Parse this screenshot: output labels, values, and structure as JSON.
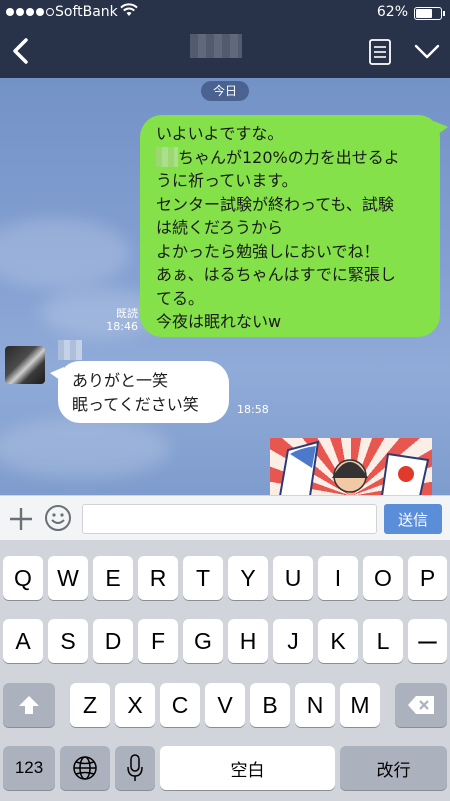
{
  "status_bar": {
    "carrier": "SoftBank",
    "signal_bars": 4,
    "battery_text": "62%",
    "battery_level": 0.62
  },
  "nav": {
    "back_icon": "chevron-left-icon",
    "notes_icon": "notes-icon",
    "menu_icon": "chevron-down-icon"
  },
  "chat": {
    "date_label": "今日",
    "outgoing": {
      "lines": [
        "いよいよですな。",
        "ちゃんが120%の力を出せるよ",
        "うに祈っています。",
        "センター試験が終わっても、試験",
        "は続くだろうから",
        "よかったら勉強しにおいでね！",
        "あぁ、はるちゃんはすでに緊張し",
        "てる。",
        "今夜は眠れないw"
      ],
      "read_label": "既読",
      "time": "18:46"
    },
    "incoming": {
      "lines": [
        "ありがと一笑",
        "眠ってください笑"
      ],
      "time": "18:58"
    }
  },
  "input_bar": {
    "plus_icon": "plus-icon",
    "emoji_icon": "smiley-icon",
    "message_value": "",
    "send_label": "送信"
  },
  "keyboard": {
    "row1": [
      "Q",
      "W",
      "E",
      "R",
      "T",
      "Y",
      "U",
      "I",
      "O",
      "P"
    ],
    "row2": [
      "A",
      "S",
      "D",
      "F",
      "G",
      "H",
      "J",
      "K",
      "L",
      "ー"
    ],
    "row3": [
      "Z",
      "X",
      "C",
      "V",
      "B",
      "N",
      "M"
    ],
    "numbers_label": "123",
    "space_label": "空白",
    "return_label": "改行"
  },
  "colors": {
    "header": "#283248",
    "outgoing_bubble": "#84e14a",
    "send_button": "#5b8ed9"
  }
}
